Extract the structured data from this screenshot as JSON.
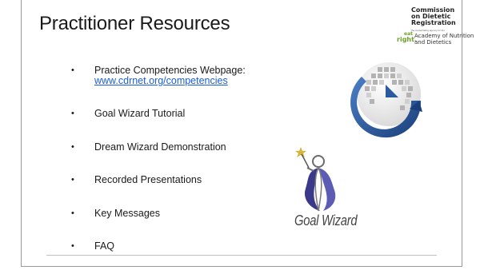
{
  "slide": {
    "title": "Practitioner Resources",
    "bullets": [
      {
        "line1": "Practice Competencies Webpage:",
        "link": "www.cdrnet.org/competencies"
      },
      {
        "line1": "Goal Wizard Tutorial"
      },
      {
        "line1": "Dream Wizard Demonstration"
      },
      {
        "line1": "Recorded Presentations"
      },
      {
        "line1": "Key Messages"
      },
      {
        "line1": "FAQ"
      }
    ],
    "bullet_char": "•"
  },
  "logo": {
    "cdr_line1": "Commission",
    "cdr_line2": "on Dietetic",
    "cdr_line3": "Registration",
    "tagline": "the credentialing agency for the",
    "eat": "eat",
    "right": "right.",
    "academy_line1": "Academy of Nutrition",
    "academy_line2": "and Dietetics",
    "brand_colors": {
      "green": "#6ea02c",
      "blue": "#1f5aa6",
      "gray": "#9a9a9a"
    }
  },
  "goal_wizard": {
    "caption": "Goal Wizard",
    "colors": {
      "cape": "#3b3a8a",
      "outline": "#7a7a7a",
      "star": "#d7b53b"
    }
  },
  "globe_graphic": {
    "icon": "refresh-globe-icon",
    "colors": {
      "arrow": "#2a5aa0",
      "squares": "#b0b0b0"
    }
  }
}
